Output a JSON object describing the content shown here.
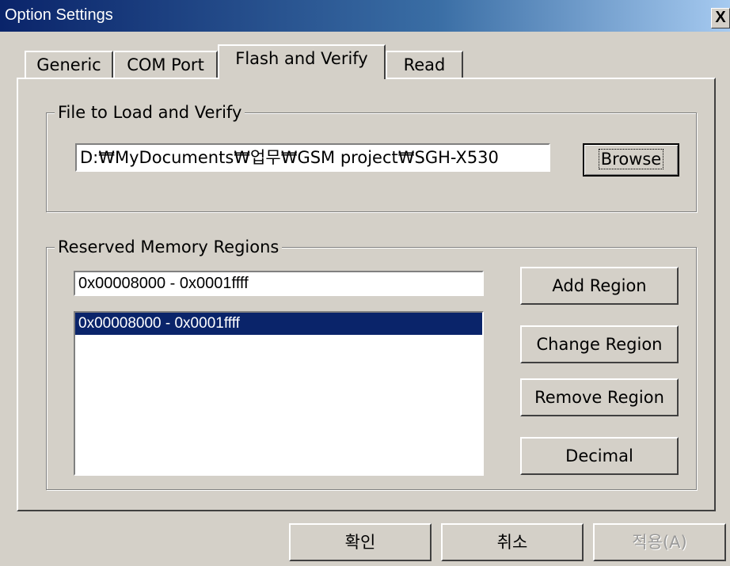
{
  "window": {
    "title": "Option Settings",
    "close_glyph": "X"
  },
  "tabs": [
    {
      "label": "Generic",
      "active": false
    },
    {
      "label": "COM Port",
      "active": false
    },
    {
      "label": "Flash and Verify",
      "active": true
    },
    {
      "label": "Read",
      "active": false
    }
  ],
  "file_group": {
    "legend": "File to Load and Verify",
    "path_value": "D:₩MyDocuments₩업무₩GSM project₩SGH-X530",
    "browse_label": "Browse"
  },
  "memory_group": {
    "legend": "Reserved Memory Regions",
    "region_input_value": "0x00008000 - 0x0001ffff",
    "regions": [
      "0x00008000 - 0x0001ffff"
    ],
    "buttons": {
      "add": "Add Region",
      "change": "Change Region",
      "remove": "Remove Region",
      "decimal": "Decimal"
    }
  },
  "footer": {
    "ok": "확인",
    "cancel": "취소",
    "apply": "적용(A)"
  },
  "colors": {
    "face": "#d4d0c8",
    "title_start": "#0a246a",
    "title_end": "#a6caf0",
    "selection": "#0a246a"
  }
}
